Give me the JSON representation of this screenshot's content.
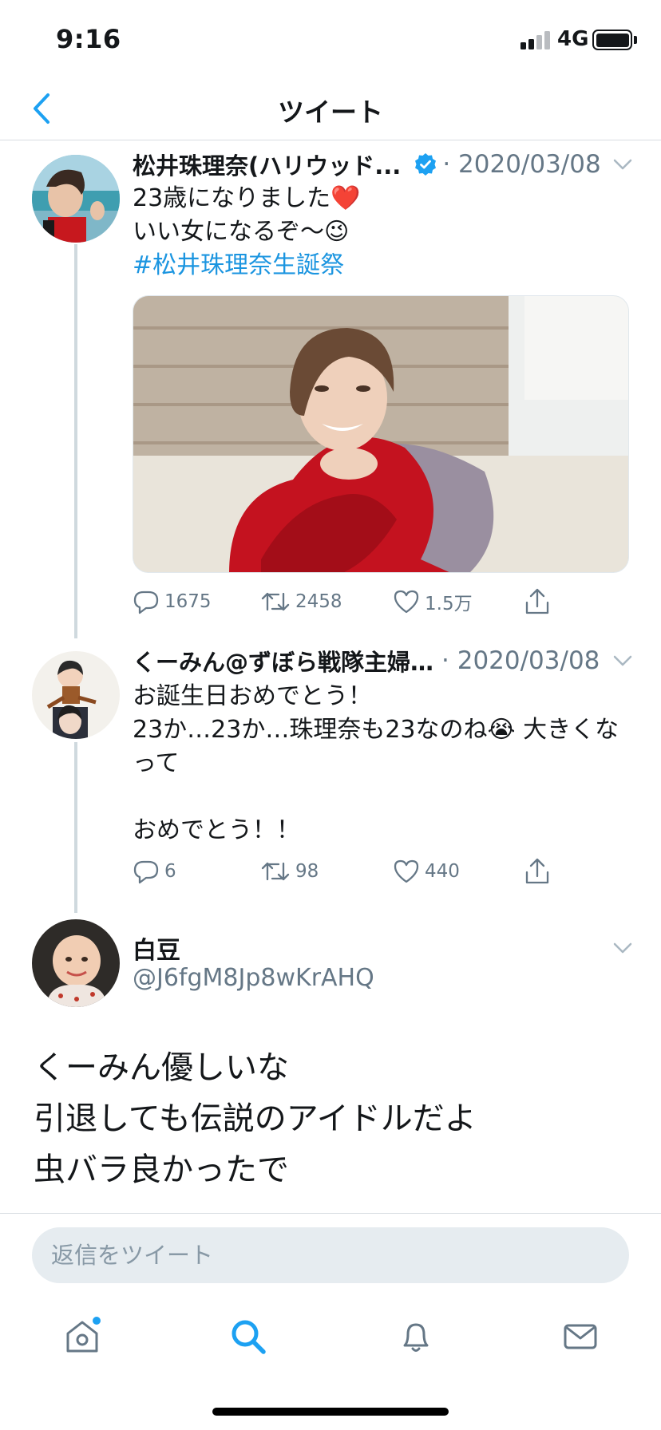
{
  "status_bar": {
    "time": "9:16",
    "network": "4G",
    "signal_bars": 2,
    "battery_level": 1.0
  },
  "header": {
    "title": "ツイート",
    "back_icon": "chevron-left-icon"
  },
  "tweets": [
    {
      "author": "松井珠理奈(ハリウッド...",
      "verified": true,
      "date": "· 2020/03/08",
      "text_lines": [
        "23歳になりました❤️",
        "いい女になるぞ〜😉"
      ],
      "hashtag": "#松井珠理奈生誕祭",
      "has_photo": true,
      "stats": {
        "replies": "1675",
        "retweets": "2458",
        "likes": "1.5万"
      }
    },
    {
      "author": "くーみん@ずぼら戦隊主婦…",
      "verified": false,
      "date": "· 2020/03/08",
      "text_lines": [
        "お誕生日おめでとう！",
        "23か…23か…珠理奈も23なのね😭 大きくな",
        "って",
        "",
        "おめでとう！！"
      ],
      "stats": {
        "replies": "6",
        "retweets": "98",
        "likes": "440"
      }
    }
  ],
  "focused_tweet": {
    "name": "白豆",
    "handle": "@J6fgM8Jp8wKrAHQ",
    "text_lines": [
      "くーみん優しいな",
      "引退しても伝説のアイドルだよ",
      "虫バラ良かったで"
    ]
  },
  "composer": {
    "placeholder": "返信をツイート"
  },
  "tab_bar": {
    "items": [
      "home-icon",
      "search-icon",
      "notifications-icon",
      "messages-icon"
    ],
    "active": "search-icon"
  },
  "colors": {
    "accent": "#1DA1F2",
    "text": "#14171A",
    "secondary": "#657786"
  }
}
